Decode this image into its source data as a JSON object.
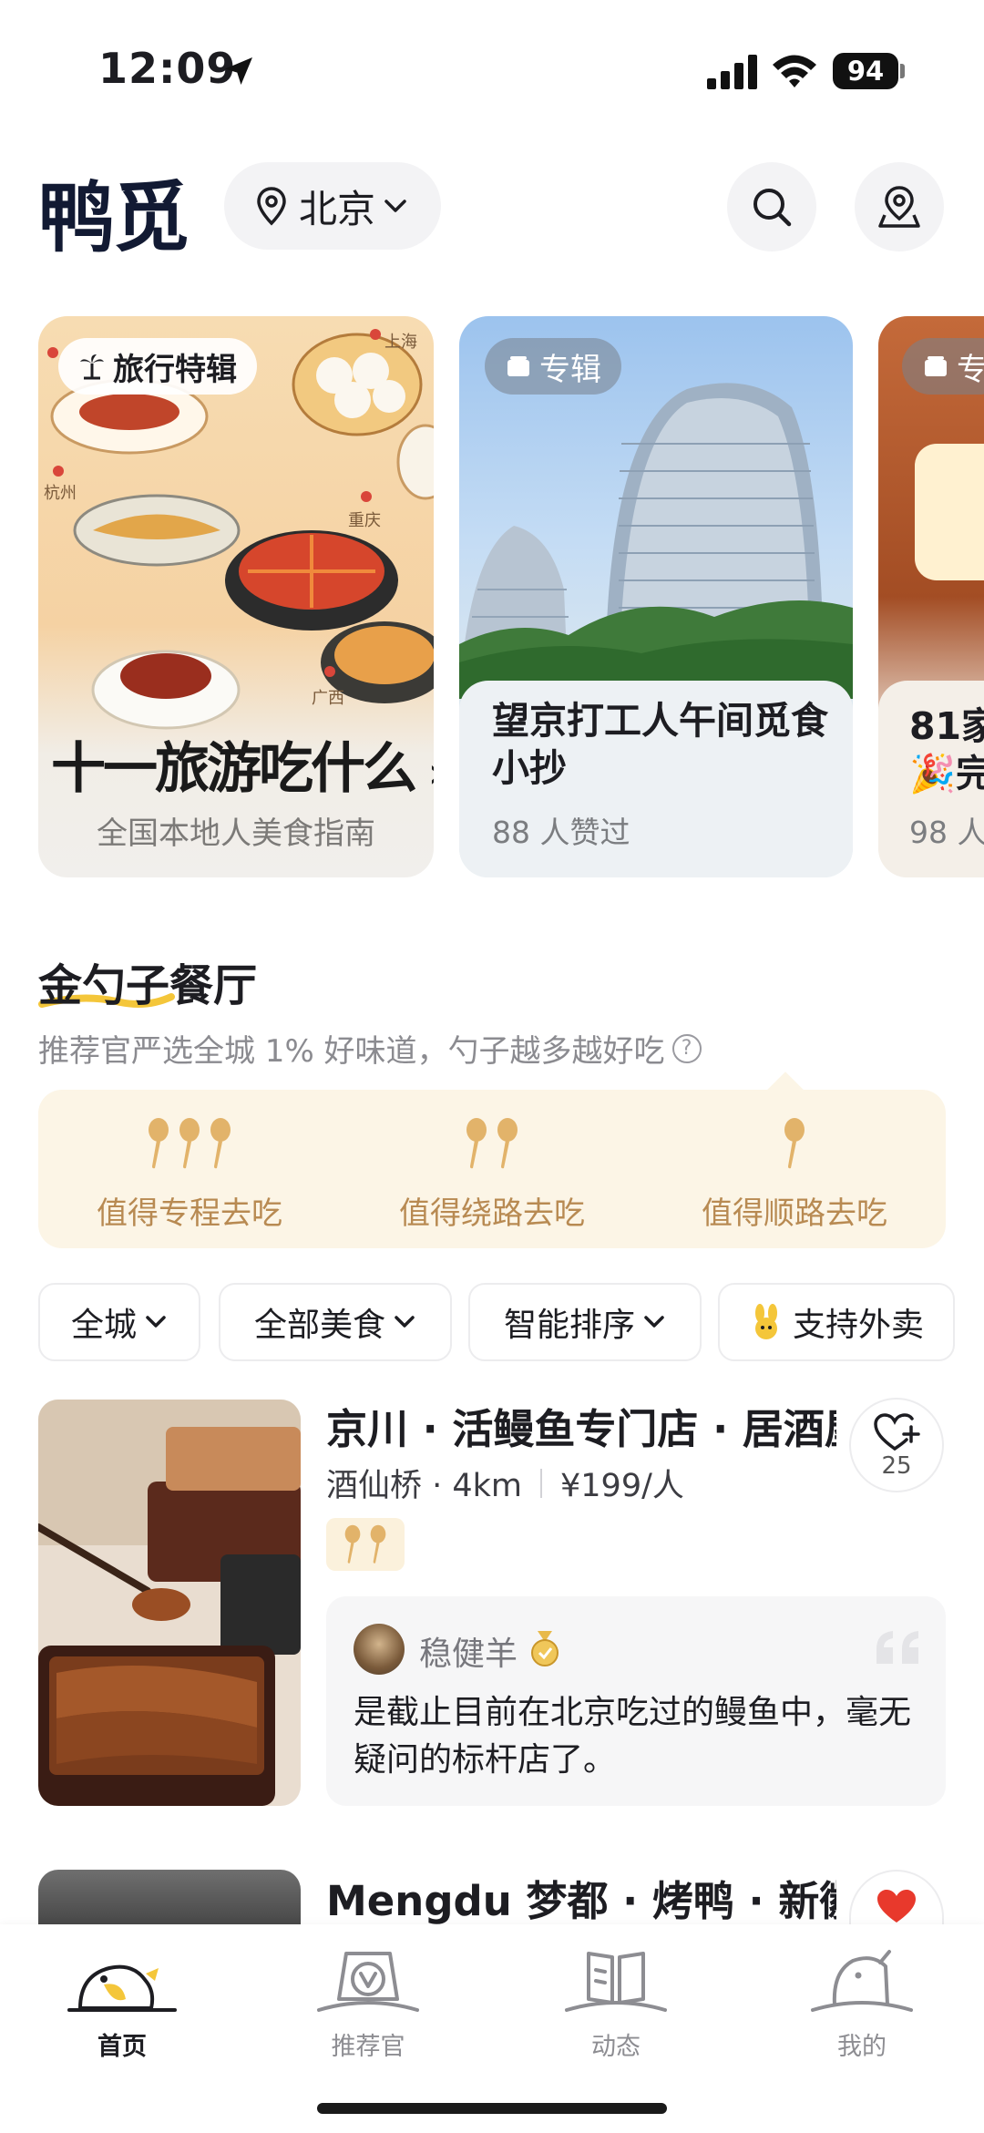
{
  "status_bar": {
    "time": "12:09",
    "battery": "94"
  },
  "header": {
    "logo": "鸭觅",
    "city": "北京"
  },
  "cards": [
    {
      "badge": "旅行特辑",
      "title": "十一旅游吃什么",
      "subtitle": "全国本地人美食指南",
      "map_labels": [
        "上海",
        "杭州",
        "重庆",
        "广西"
      ]
    },
    {
      "badge": "专辑",
      "title": "望京打工人午间觅食小抄",
      "subtitle": "88 人赞过"
    },
    {
      "badge": "专",
      "title_line1": "81家",
      "title_line2": "🎉完",
      "subtitle": "98 人"
    }
  ],
  "golden_spoon": {
    "title": "金勺子餐厅",
    "subtitle": "推荐官严选全城 1% 好味道，勺子越多越好吃",
    "levels": [
      {
        "spoons": 3,
        "label": "值得专程去吃"
      },
      {
        "spoons": 2,
        "label": "值得绕路去吃"
      },
      {
        "spoons": 1,
        "label": "值得顺路去吃"
      }
    ]
  },
  "filters": {
    "city": "全城",
    "cuisine": "全部美食",
    "sort": "智能排序",
    "delivery": "支持外卖"
  },
  "restaurants": [
    {
      "name": "京川 · 活鳗鱼专门店 · 居酒屋",
      "area": "酒仙桥 · 4km",
      "price": "¥199/人",
      "spoons": 2,
      "favorites": "25",
      "review": {
        "user": "稳健羊",
        "text": "是截止目前在北京吃过的鳗鱼中，毫无疑问的标杆店了。"
      }
    },
    {
      "name": "Mengdu 梦都 · 烤鸭 · 新徽菜"
    }
  ],
  "tabbar": [
    {
      "label": "首页",
      "active": true
    },
    {
      "label": "推荐官",
      "active": false
    },
    {
      "label": "动态",
      "active": false
    },
    {
      "label": "我的",
      "active": false
    }
  ],
  "colors": {
    "accent_gold": "#b88a52",
    "spoon_bg": "#fcf5e6",
    "heart_red": "#e8392c",
    "logo_navy": "#121a33"
  }
}
